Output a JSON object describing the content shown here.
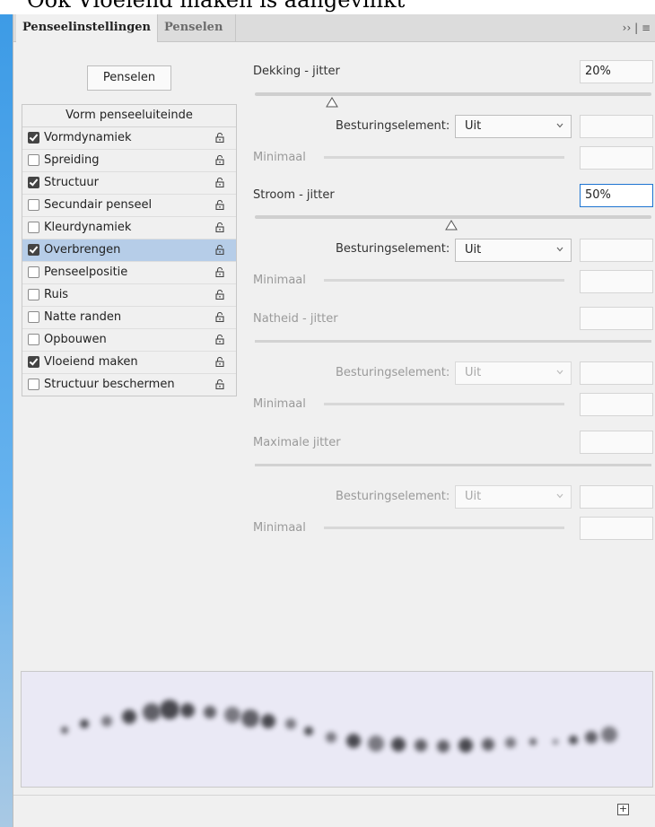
{
  "document": {
    "heading_partial": "Ook Vloeiend maken is aangevinkt"
  },
  "panel": {
    "tabs": [
      {
        "label": "Penseelinstellingen",
        "active": true
      },
      {
        "label": "Penselen",
        "active": false
      }
    ],
    "menu_icons": "›› | ≡",
    "brushes_button": "Penselen",
    "list_header": "Vorm penseeluiteinde",
    "options": [
      {
        "label": "Vormdynamiek",
        "checked": true,
        "selected": false
      },
      {
        "label": "Spreiding",
        "checked": false,
        "selected": false
      },
      {
        "label": "Structuur",
        "checked": true,
        "selected": false
      },
      {
        "label": "Secundair penseel",
        "checked": false,
        "selected": false
      },
      {
        "label": "Kleurdynamiek",
        "checked": false,
        "selected": false
      },
      {
        "label": "Overbrengen",
        "checked": true,
        "selected": true
      },
      {
        "label": "Penseelpositie",
        "checked": false,
        "selected": false
      },
      {
        "label": "Ruis",
        "checked": false,
        "selected": false
      },
      {
        "label": "Natte randen",
        "checked": false,
        "selected": false
      },
      {
        "label": "Opbouwen",
        "checked": false,
        "selected": false
      },
      {
        "label": "Vloeiend maken",
        "checked": true,
        "selected": false
      },
      {
        "label": "Structuur beschermen",
        "checked": false,
        "selected": false
      }
    ]
  },
  "settings": {
    "opacity": {
      "label": "Dekking - jitter",
      "value": "20%",
      "control_label": "Besturingselement:",
      "control_value": "Uit",
      "minimum_label": "Minimaal",
      "minimum_value": ""
    },
    "flow": {
      "label": "Stroom - jitter",
      "value": "50%",
      "control_label": "Besturingselement:",
      "control_value": "Uit",
      "minimum_label": "Minimaal",
      "minimum_value": ""
    },
    "wetness": {
      "label": "Natheid - jitter",
      "value": "",
      "control_label": "Besturingselement:",
      "control_value": "Uit",
      "minimum_label": "Minimaal",
      "minimum_value": ""
    },
    "mix": {
      "label": "Maximale jitter",
      "value": "",
      "control_label": "Besturingselement:",
      "control_value": "Uit",
      "minimum_label": "Minimaal",
      "minimum_value": ""
    }
  },
  "footer": {
    "new_preset_icon": "+"
  },
  "colors": {
    "selection": "#b6cde8",
    "focus": "#1d74d1",
    "preview_bg": "#eae9f5"
  }
}
